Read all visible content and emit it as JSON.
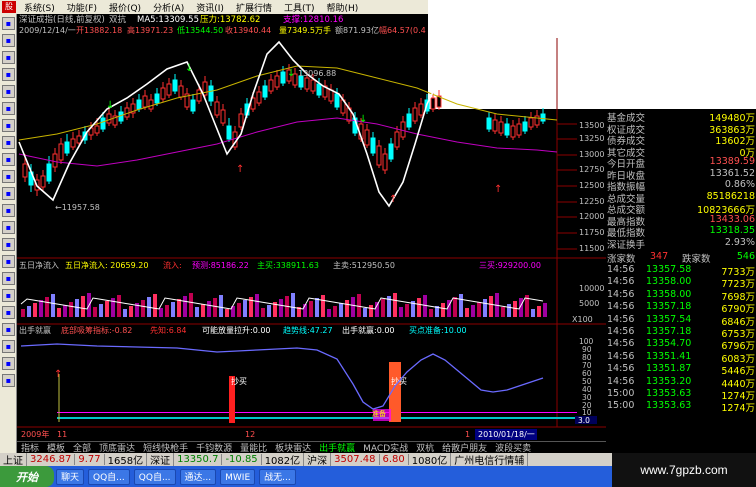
{
  "menu": {
    "items": [
      "系统(S)",
      "功能(F)",
      "报价(Q)",
      "分析(A)",
      "资讯(I)",
      "扩展行情",
      "工具(T)",
      "帮助(H)"
    ]
  },
  "chart_header": {
    "line1": [
      "深证成指(日线,前复权)",
      "双抗",
      "MA5:13309.55",
      "压力:13782.62",
      "支撑:12810.16"
    ],
    "line2": [
      "2009/12/14/一",
      "开13882.18",
      "高13971.23",
      "低13544.50",
      "收13940.44",
      "量7349.5万手",
      "额871.93亿",
      "幅64.57(0.4"
    ],
    "max_label": "13096.88",
    "min_label": "←11957.58"
  },
  "price_axis": [
    "13500",
    "13250",
    "13000",
    "12750",
    "12500",
    "12250",
    "12000",
    "11750",
    "11500"
  ],
  "flow_header": {
    "title": "五日净流入",
    "a": "五日净流入: 20659.20",
    "b": "流入:",
    "c": "预测:85186.22",
    "d": "主买:338911.63",
    "e": "主卖:512950.50",
    "f": "三买:929200.00"
  },
  "flow_axis": [
    "10000",
    "5000",
    "X100"
  ],
  "ind_header": {
    "title": "出手就赢",
    "a": "底部吸筹指标:-0.82",
    "b": "先知:6.84",
    "c": "可能放量拉升:0.00",
    "d": "趋势线:47.27",
    "e": "出手就赢:0.00",
    "f": "买点准备:10.00"
  },
  "ind_axis": [
    "100",
    "90",
    "80",
    "70",
    "60",
    "50",
    "40",
    "30",
    "20",
    "10",
    "3.0"
  ],
  "ind_labels": {
    "buy1": "抄买",
    "buy2": "抄买",
    "zero": "准备"
  },
  "date_axis": {
    "left": "2009年",
    "month1": "11",
    "month2": "12",
    "month3": "1",
    "cursor": "2010/01/18/一"
  },
  "tabs": [
    "指标",
    "模板",
    "全部",
    "顶底雷达",
    "短线快枪手",
    "千钧数源",
    "量能比",
    "板块雷达",
    "出手就赢",
    "MACD实战",
    "双杭",
    "给散户朋友",
    "波段买卖"
  ],
  "right_panel": {
    "rows": [
      {
        "label": "基金成交",
        "value": "149480万",
        "color": "#ffff00"
      },
      {
        "label": "权证成交",
        "value": "363863万",
        "color": "#ffff00"
      },
      {
        "label": "债券成交",
        "value": "13602万",
        "color": "#ffff00"
      },
      {
        "label": "其它成交",
        "value": "0万",
        "color": "#ffff00"
      },
      {
        "label": "今日开盘",
        "value": "13389.59",
        "color": "#ff5050"
      },
      {
        "label": "昨日收盘",
        "value": "13361.52",
        "color": "#c0c0c0"
      },
      {
        "label": "指数振幅",
        "value": "0.86%",
        "color": "#c0c0c0"
      },
      {
        "label": "总成交量",
        "value": "85186218",
        "color": "#ffff00"
      },
      {
        "label": "总成交额",
        "value": "10823666万",
        "color": "#ffff00"
      },
      {
        "label": "最高指数",
        "value": "13433.06",
        "color": "#ff5050"
      },
      {
        "label": "最低指数",
        "value": "13318.35",
        "color": "#00ff00"
      },
      {
        "label": "深证换手",
        "value": "2.93%",
        "color": "#c0c0c0"
      }
    ],
    "updown": {
      "up_label": "涨家数",
      "up": "347",
      "down_label": "跌家数",
      "down": "546"
    },
    "ticks": [
      {
        "t": "14:56",
        "p": "13357.58",
        "v": "7733万",
        "c": "#00ff00"
      },
      {
        "t": "14:56",
        "p": "13358.00",
        "v": "7723万",
        "c": "#00ff00"
      },
      {
        "t": "14:56",
        "p": "13358.00",
        "v": "7698万",
        "c": "#00ff00"
      },
      {
        "t": "14:56",
        "p": "13357.18",
        "v": "6790万",
        "c": "#00ff00"
      },
      {
        "t": "14:56",
        "p": "13357.54",
        "v": "6846万",
        "c": "#00ff00"
      },
      {
        "t": "14:56",
        "p": "13357.18",
        "v": "6753万",
        "c": "#00ff00"
      },
      {
        "t": "14:56",
        "p": "13354.70",
        "v": "6796万",
        "c": "#00ff00"
      },
      {
        "t": "14:56",
        "p": "13351.41",
        "v": "6083万",
        "c": "#00ff00"
      },
      {
        "t": "14:56",
        "p": "13351.87",
        "v": "5446万",
        "c": "#00ff00"
      },
      {
        "t": "14:56",
        "p": "13353.20",
        "v": "4440万",
        "c": "#00ff00"
      },
      {
        "t": "15:00",
        "p": "13353.63",
        "v": "1274万",
        "c": "#00ff00"
      },
      {
        "t": "15:00",
        "p": "13353.63",
        "v": "1274万",
        "c": "#00ff00"
      }
    ]
  },
  "statusbar": {
    "a": "上证",
    "av": "3246.87",
    "ac": "9.77",
    "ad": "1658亿",
    "b": "深证",
    "bv": "13350.7",
    "bc": "-10.85",
    "bd": "1082亿",
    "c": "沪深",
    "cv": "3507.48",
    "cc": "6.80",
    "cd": "1080亿",
    "e": "广州电信行情辅"
  },
  "taskbar": {
    "start": "开始",
    "items": [
      "聊天",
      "QQ自...",
      "QQ自...",
      "通达...",
      "MWIE",
      "战无..."
    ]
  },
  "watermark": "www.7gpzb.com",
  "colors": {
    "up": "#ff3030",
    "down": "#00ffff",
    "ma_white": "#ffffff",
    "ma_yellow": "#c8b400",
    "ma_magenta": "#c000c0",
    "accent_green": "#00ff00"
  }
}
